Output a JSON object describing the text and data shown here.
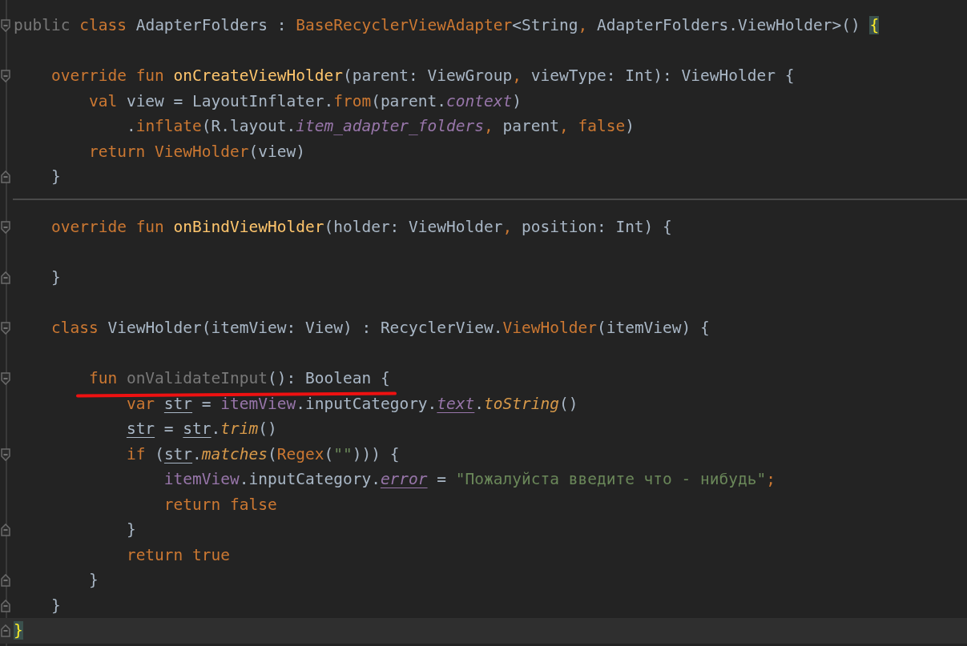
{
  "editor": {
    "lines": [
      {
        "kind": "code",
        "fold_start": true,
        "tokens": [
          {
            "kind": "unused",
            "text": "public"
          },
          {
            "kind": "kw",
            "text": " class"
          },
          {
            "kind": "plain",
            "text": " AdapterFolders : "
          },
          {
            "kind": "kw",
            "text": "BaseRecyclerViewAdapter"
          },
          {
            "kind": "plain",
            "text": "<String"
          },
          {
            "kind": "kw",
            "text": ","
          },
          {
            "kind": "plain",
            "text": " AdapterFolders.ViewHolder>() "
          },
          {
            "kind": "brace_match",
            "text": "{"
          }
        ]
      },
      {
        "kind": "blank"
      },
      {
        "kind": "code",
        "fold_start": true,
        "tokens": [
          {
            "kind": "kw",
            "text": "    override fun "
          },
          {
            "kind": "fn",
            "text": "onCreateViewHolder"
          },
          {
            "kind": "plain",
            "text": "(parent: ViewGroup"
          },
          {
            "kind": "kw",
            "text": ","
          },
          {
            "kind": "plain",
            "text": " viewType: Int): ViewHolder {"
          }
        ]
      },
      {
        "kind": "code",
        "tokens": [
          {
            "kind": "kw",
            "text": "        val "
          },
          {
            "kind": "plain",
            "text": "view = LayoutInflater."
          },
          {
            "kind": "kw",
            "text": "from"
          },
          {
            "kind": "plain",
            "text": "(parent."
          },
          {
            "kind": "prop",
            "text": "context"
          },
          {
            "kind": "plain",
            "text": ")"
          }
        ]
      },
      {
        "kind": "code",
        "tokens": [
          {
            "kind": "plain",
            "text": "            ."
          },
          {
            "kind": "kw",
            "text": "inflate"
          },
          {
            "kind": "plain",
            "text": "(R.layout."
          },
          {
            "kind": "prop",
            "text": "item_adapter_folders"
          },
          {
            "kind": "kw",
            "text": ","
          },
          {
            "kind": "plain",
            "text": " parent"
          },
          {
            "kind": "kw",
            "text": ", false"
          },
          {
            "kind": "plain",
            "text": ")"
          }
        ]
      },
      {
        "kind": "code",
        "tokens": [
          {
            "kind": "kw",
            "text": "        return ViewHolder"
          },
          {
            "kind": "plain",
            "text": "(view)"
          }
        ]
      },
      {
        "kind": "code",
        "fold_end": true,
        "tokens": [
          {
            "kind": "plain",
            "text": "    }"
          }
        ]
      },
      {
        "kind": "separator"
      },
      {
        "kind": "code",
        "fold_start": true,
        "tokens": [
          {
            "kind": "kw",
            "text": "    override fun "
          },
          {
            "kind": "fn",
            "text": "onBindViewHolder"
          },
          {
            "kind": "plain",
            "text": "(holder: ViewHolder"
          },
          {
            "kind": "kw",
            "text": ","
          },
          {
            "kind": "plain",
            "text": " position: Int) {"
          }
        ]
      },
      {
        "kind": "blank"
      },
      {
        "kind": "code",
        "fold_end": true,
        "tokens": [
          {
            "kind": "plain",
            "text": "    }"
          }
        ]
      },
      {
        "kind": "blank"
      },
      {
        "kind": "code",
        "fold_start": true,
        "tokens": [
          {
            "kind": "kw",
            "text": "    class "
          },
          {
            "kind": "plain",
            "text": "ViewHolder(itemView: View) : RecyclerView."
          },
          {
            "kind": "kw",
            "text": "ViewHolder"
          },
          {
            "kind": "plain",
            "text": "(itemView) {"
          }
        ]
      },
      {
        "kind": "blank"
      },
      {
        "kind": "code",
        "fold_start": true,
        "marked": true,
        "tokens": [
          {
            "kind": "kw",
            "text": "        fun "
          },
          {
            "kind": "unused",
            "text": "onValidateInput"
          },
          {
            "kind": "plain",
            "text": "(): Boolean {"
          }
        ]
      },
      {
        "kind": "code",
        "tokens": [
          {
            "kind": "kw",
            "text": "            var "
          },
          {
            "kind": "local",
            "text": "str"
          },
          {
            "kind": "plain",
            "text": " = "
          },
          {
            "kind": "synthetic",
            "text": "itemView"
          },
          {
            "kind": "plain",
            "text": ".inputCategory."
          },
          {
            "kind": "prop_u",
            "text": "text"
          },
          {
            "kind": "plain",
            "text": "."
          },
          {
            "kind": "ext",
            "text": "toString"
          },
          {
            "kind": "plain",
            "text": "()"
          }
        ]
      },
      {
        "kind": "code",
        "tokens": [
          {
            "kind": "local",
            "text": "            str"
          },
          {
            "kind": "plain",
            "text": " = "
          },
          {
            "kind": "local",
            "text": "str"
          },
          {
            "kind": "plain",
            "text": "."
          },
          {
            "kind": "ext",
            "text": "trim"
          },
          {
            "kind": "plain",
            "text": "()"
          }
        ]
      },
      {
        "kind": "code",
        "fold_start": true,
        "tokens": [
          {
            "kind": "kw",
            "text": "            if "
          },
          {
            "kind": "plain",
            "text": "("
          },
          {
            "kind": "local",
            "text": "str"
          },
          {
            "kind": "plain",
            "text": "."
          },
          {
            "kind": "ext",
            "text": "matches"
          },
          {
            "kind": "plain",
            "text": "("
          },
          {
            "kind": "kw",
            "text": "Regex"
          },
          {
            "kind": "plain",
            "text": "("
          },
          {
            "kind": "string",
            "text": "\"\""
          },
          {
            "kind": "plain",
            "text": "))) {"
          }
        ]
      },
      {
        "kind": "code",
        "tokens": [
          {
            "kind": "synthetic",
            "text": "                itemView"
          },
          {
            "kind": "plain",
            "text": ".inputCategory."
          },
          {
            "kind": "prop_u",
            "text": "error"
          },
          {
            "kind": "plain",
            "text": " = "
          },
          {
            "kind": "string",
            "text": "\"Пожалуйста введите что - нибудь\""
          },
          {
            "kind": "kw",
            "text": ";"
          }
        ]
      },
      {
        "kind": "code",
        "tokens": [
          {
            "kind": "kw",
            "text": "                return false"
          }
        ]
      },
      {
        "kind": "code",
        "fold_end": true,
        "tokens": [
          {
            "kind": "plain",
            "text": "            }"
          }
        ]
      },
      {
        "kind": "code",
        "tokens": [
          {
            "kind": "kw",
            "text": "            return true"
          }
        ]
      },
      {
        "kind": "code",
        "fold_end": true,
        "tokens": [
          {
            "kind": "plain",
            "text": "        }"
          }
        ]
      },
      {
        "kind": "code",
        "fold_end": true,
        "tokens": [
          {
            "kind": "plain",
            "text": "    }"
          }
        ]
      },
      {
        "kind": "code",
        "fold_end": true,
        "current": true,
        "tokens": [
          {
            "kind": "brace_match",
            "text": "}"
          }
        ]
      }
    ]
  }
}
